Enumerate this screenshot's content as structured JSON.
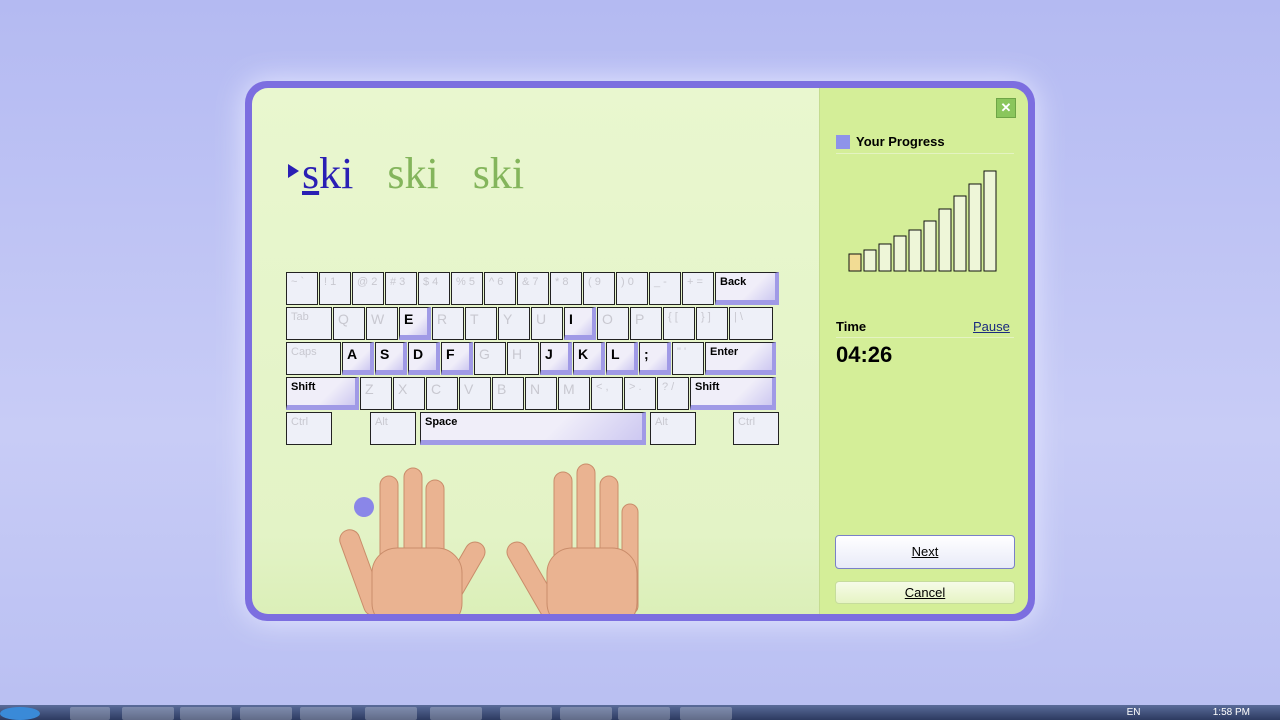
{
  "lesson": {
    "words": [
      "ski",
      "ski",
      "ski"
    ],
    "current_word": 0,
    "current_letter": 0
  },
  "keyboard": {
    "rows": [
      [
        {
          "l": "~ `"
        },
        {
          "l": "! 1"
        },
        {
          "l": "@ 2"
        },
        {
          "l": "# 3"
        },
        {
          "l": "$ 4"
        },
        {
          "l": "% 5"
        },
        {
          "l": "^ 6"
        },
        {
          "l": "& 7"
        },
        {
          "l": "* 8"
        },
        {
          "l": "( 9"
        },
        {
          "l": ") 0"
        },
        {
          "l": "_ -"
        },
        {
          "l": "+ ="
        },
        {
          "l": "Back",
          "on": true
        }
      ],
      [
        {
          "l": "Tab"
        },
        {
          "l": "Q"
        },
        {
          "l": "W"
        },
        {
          "l": "E",
          "on": true
        },
        {
          "l": "R"
        },
        {
          "l": "T"
        },
        {
          "l": "Y"
        },
        {
          "l": "U"
        },
        {
          "l": "I",
          "on": true
        },
        {
          "l": "O"
        },
        {
          "l": "P"
        },
        {
          "l": "{ ["
        },
        {
          "l": "} ]"
        },
        {
          "l": "| \\"
        }
      ],
      [
        {
          "l": "Caps"
        },
        {
          "l": "A",
          "on": true
        },
        {
          "l": "S",
          "on": true
        },
        {
          "l": "D",
          "on": true
        },
        {
          "l": "F",
          "on": true
        },
        {
          "l": "G"
        },
        {
          "l": "H"
        },
        {
          "l": "J",
          "on": true
        },
        {
          "l": "K",
          "on": true
        },
        {
          "l": "L",
          "on": true
        },
        {
          "l": ";",
          "on": true
        },
        {
          "l": "\" '"
        },
        {
          "l": "Enter",
          "on": true
        }
      ],
      [
        {
          "l": "Shift",
          "on": true
        },
        {
          "l": "Z"
        },
        {
          "l": "X"
        },
        {
          "l": "C"
        },
        {
          "l": "V"
        },
        {
          "l": "B"
        },
        {
          "l": "N"
        },
        {
          "l": "M"
        },
        {
          "l": "< ,"
        },
        {
          "l": "> ."
        },
        {
          "l": "? /"
        },
        {
          "l": "Shift",
          "on": true
        }
      ],
      [
        {
          "l": "Ctrl"
        },
        {
          "l": "Alt"
        },
        {
          "l": "Space",
          "on": true
        },
        {
          "l": "Alt"
        },
        {
          "l": "Ctrl"
        }
      ]
    ]
  },
  "sidebar": {
    "close_icon": "close-icon",
    "progress_title": "Your Progress",
    "progress_icon": "bar-chart-icon",
    "time_label": "Time",
    "pause_label": "Pause",
    "time_value": "04:26",
    "next_label": "Next",
    "cancel_label": "Cancel"
  },
  "chart_data": {
    "type": "bar",
    "values": [
      17,
      21,
      27,
      35,
      41,
      50,
      62,
      75,
      87,
      100
    ],
    "current_index": 0,
    "colors": {
      "current": "#f2dc94",
      "other": "#eef6d8"
    }
  },
  "taskbar": {
    "clock": "1:58 PM",
    "lang": "EN"
  }
}
